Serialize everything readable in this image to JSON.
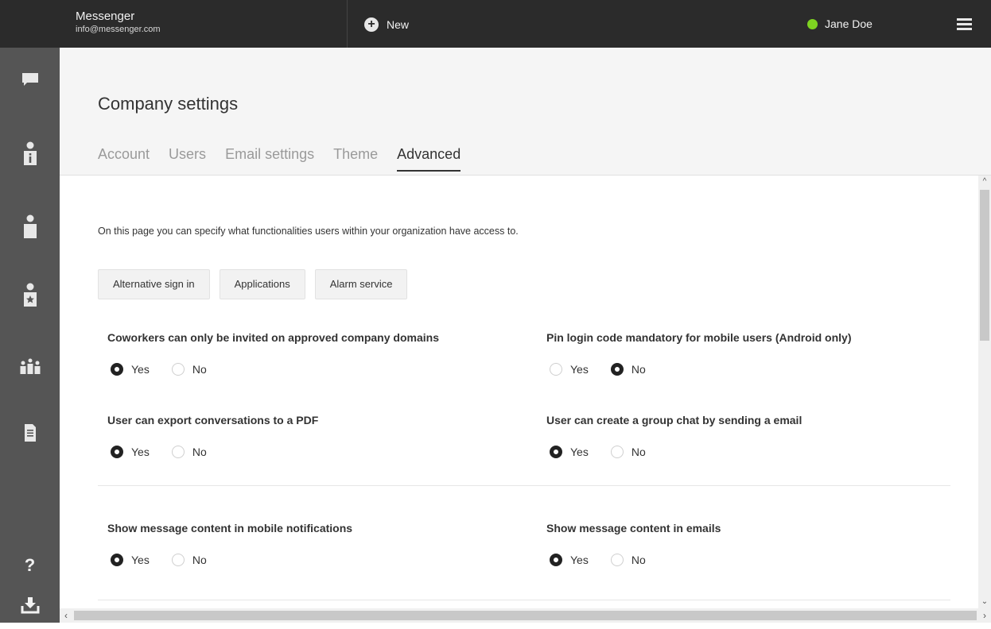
{
  "app": {
    "name": "Messenger",
    "email": "info@messenger.com"
  },
  "topbar": {
    "new_label": "New",
    "user_name": "Jane Doe",
    "status_color": "#7ed321"
  },
  "sidebar": {
    "items": [
      {
        "icon": "chat-icon"
      },
      {
        "icon": "user-info-icon"
      },
      {
        "icon": "user-icon"
      },
      {
        "icon": "user-star-icon"
      },
      {
        "icon": "group-icon"
      },
      {
        "icon": "document-icon"
      }
    ],
    "help_label": "?",
    "bottom_icon": "download-icon"
  },
  "page": {
    "title": "Company settings",
    "tabs": [
      {
        "label": "Account",
        "active": false
      },
      {
        "label": "Users",
        "active": false
      },
      {
        "label": "Email settings",
        "active": false
      },
      {
        "label": "Theme",
        "active": false
      },
      {
        "label": "Advanced",
        "active": true
      }
    ]
  },
  "content": {
    "intro": "On this page you can specify what functionalities users within your organization have access to.",
    "buttons": [
      "Alternative sign in",
      "Applications",
      "Alarm service"
    ],
    "settings": [
      {
        "label": "Coworkers can only be invited on approved company domains",
        "yes": "Yes",
        "no": "No",
        "value": "Yes"
      },
      {
        "label": "Pin login code mandatory for mobile users (Android only)",
        "yes": "Yes",
        "no": "No",
        "value": "No"
      },
      {
        "label": "User can export conversations to a PDF",
        "yes": "Yes",
        "no": "No",
        "value": "Yes"
      },
      {
        "label": "User can create a group chat by sending a email",
        "yes": "Yes",
        "no": "No",
        "value": "Yes"
      },
      {
        "label": "Show message content in mobile notifications",
        "yes": "Yes",
        "no": "No",
        "value": "Yes"
      },
      {
        "label": "Show message content in emails",
        "yes": "Yes",
        "no": "No",
        "value": "Yes"
      }
    ]
  }
}
